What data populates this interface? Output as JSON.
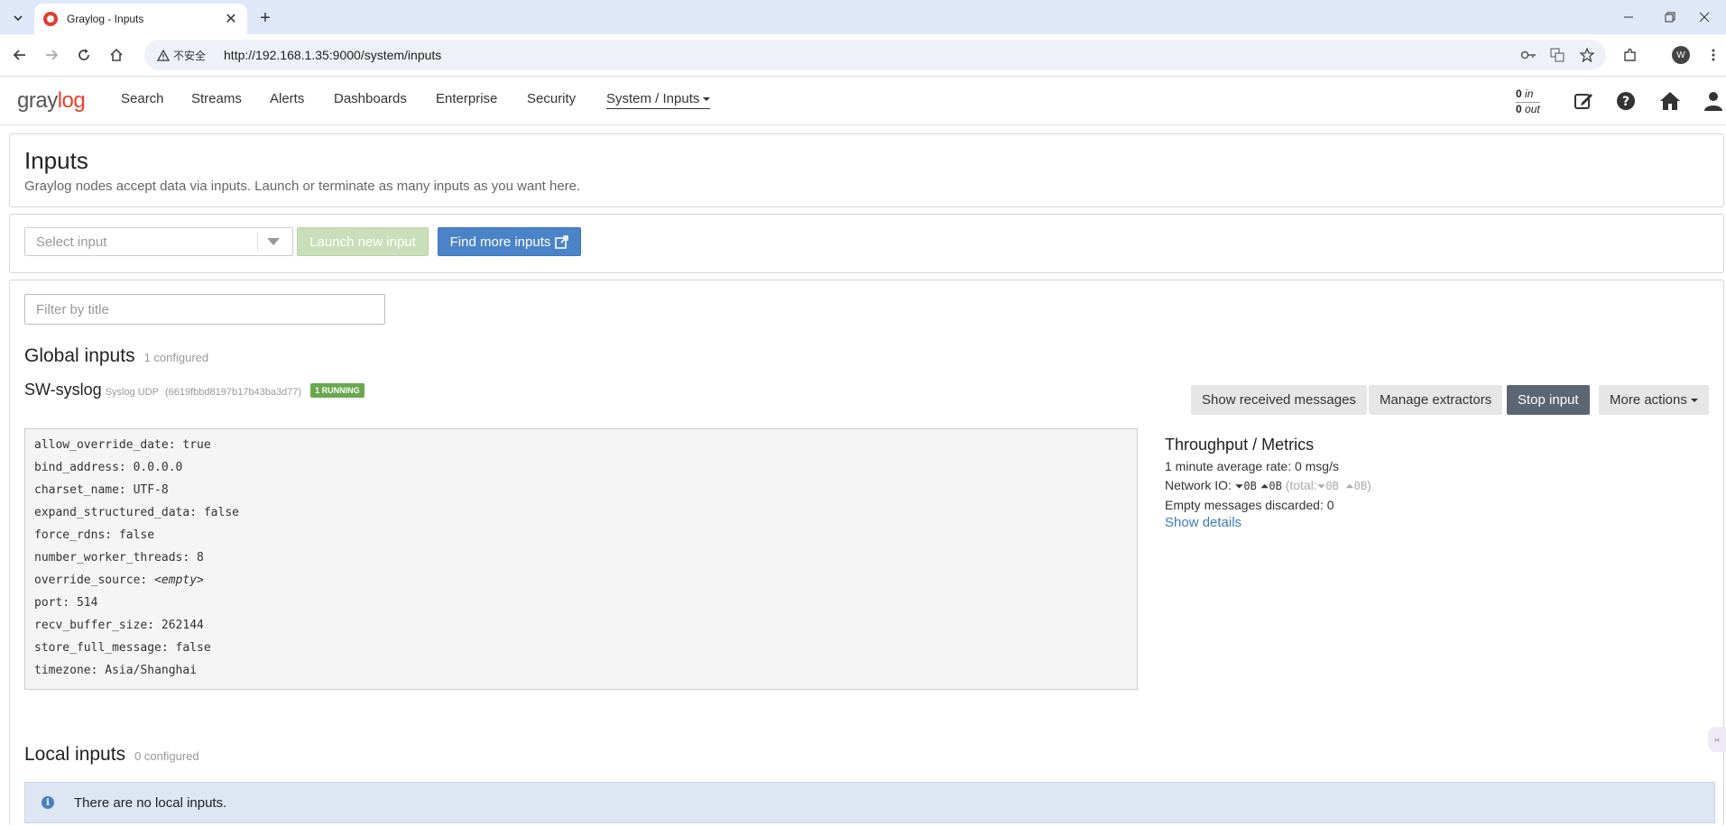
{
  "browser": {
    "tab_title": "Graylog - Inputs",
    "insecure_label": "不安全",
    "url": "http://192.168.1.35:9000/system/inputs",
    "profile_initial": "W"
  },
  "nav": {
    "logo_prefix": "gray",
    "logo_suffix": "log",
    "items": [
      "Search",
      "Streams",
      "Alerts",
      "Dashboards",
      "Enterprise",
      "Security",
      "System / Inputs"
    ],
    "throughput_in": "0",
    "throughput_in_label": "in",
    "throughput_out": "0",
    "throughput_out_label": "out"
  },
  "header": {
    "title": "Inputs",
    "description": "Graylog nodes accept data via inputs. Launch or terminate as many inputs as you want here."
  },
  "launch": {
    "select_placeholder": "Select input",
    "launch_label": "Launch new input",
    "find_label": "Find more inputs"
  },
  "filter": {
    "placeholder": "Filter by title"
  },
  "global_inputs": {
    "title": "Global inputs",
    "count": "1 configured",
    "input": {
      "name": "SW-syslog",
      "type": "Syslog UDP",
      "id": "(6619fbbd8197b17b43ba3d77)",
      "status": "1 RUNNING",
      "actions": [
        "Show received messages",
        "Manage extractors",
        "Stop input",
        "More actions"
      ],
      "config": [
        {
          "key": "allow_override_date",
          "value": "true"
        },
        {
          "key": "bind_address",
          "value": "0.0.0.0"
        },
        {
          "key": "charset_name",
          "value": "UTF-8"
        },
        {
          "key": "expand_structured_data",
          "value": "false"
        },
        {
          "key": "force_rdns",
          "value": "false"
        },
        {
          "key": "number_worker_threads",
          "value": "8"
        },
        {
          "key": "override_source",
          "value": "<empty>"
        },
        {
          "key": "port",
          "value": "514"
        },
        {
          "key": "recv_buffer_size",
          "value": "262144"
        },
        {
          "key": "store_full_message",
          "value": "false"
        },
        {
          "key": "timezone",
          "value": "Asia/Shanghai"
        }
      ],
      "metrics": {
        "title": "Throughput / Metrics",
        "avg_rate": "1 minute average rate: 0 msg/s",
        "network_io_label": "Network IO:",
        "io_in": "0B",
        "io_out": "0B",
        "total_label": "(total:",
        "total_in": "0B",
        "total_out": "0B",
        "total_close": ")",
        "empty_discarded": "Empty messages discarded: 0",
        "show_details": "Show details"
      }
    }
  },
  "local_inputs": {
    "title": "Local inputs",
    "count": "0 configured",
    "empty_message": "There are no local inputs."
  }
}
